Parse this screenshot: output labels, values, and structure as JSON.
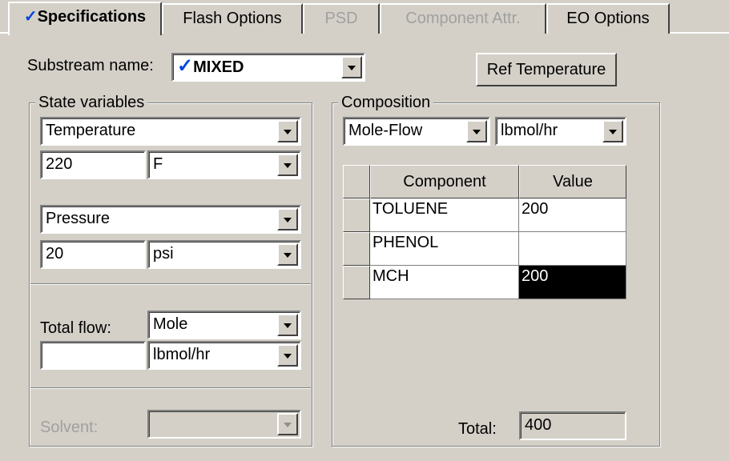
{
  "tabs": [
    {
      "label": "Specifications",
      "state": "active",
      "checked": true
    },
    {
      "label": "Flash Options",
      "state": "normal"
    },
    {
      "label": "PSD",
      "state": "disabled"
    },
    {
      "label": "Component Attr.",
      "state": "disabled"
    },
    {
      "label": "EO Options",
      "state": "normal"
    }
  ],
  "checkmark": "✓",
  "substream": {
    "label": "Substream name:",
    "value": "MIXED",
    "check": "✓"
  },
  "ref_temperature_button": "Ref Temperature",
  "state_variables": {
    "title": "State variables",
    "var1": {
      "name": "Temperature",
      "value": "220",
      "unit": "F"
    },
    "var2": {
      "name": "Pressure",
      "value": "20",
      "unit": "psi"
    },
    "total_flow": {
      "label": "Total flow:",
      "basis": "Mole",
      "value": "",
      "unit": "lbmol/hr"
    },
    "solvent": {
      "label": "Solvent:",
      "value": ""
    }
  },
  "composition": {
    "title": "Composition",
    "basis": "Mole-Flow",
    "unit": "lbmol/hr",
    "columns": [
      "Component",
      "Value"
    ],
    "rows": [
      {
        "component": "TOLUENE",
        "value": "200"
      },
      {
        "component": "PHENOL",
        "value": ""
      },
      {
        "component": "MCH",
        "value": "200"
      }
    ],
    "total_label": "Total:",
    "total_value": "400"
  },
  "colors": {
    "background": "#d4d0c8",
    "check": "#0044dd",
    "selection": "#000000"
  }
}
